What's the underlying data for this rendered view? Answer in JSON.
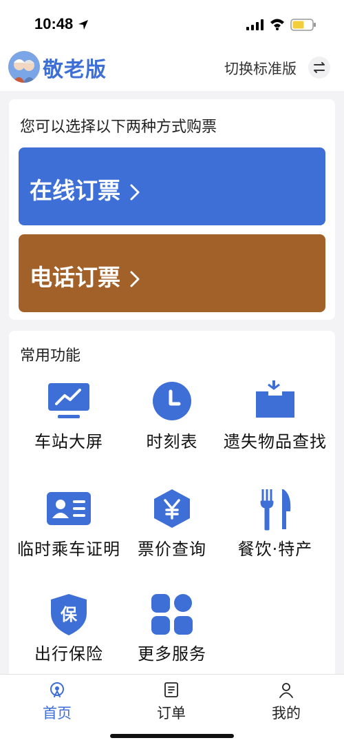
{
  "status_bar": {
    "time": "10:48",
    "icons": [
      "location-arrow-icon",
      "signal-icon",
      "wifi-icon",
      "battery-icon"
    ]
  },
  "header": {
    "brand": "敬老版",
    "switch_label": "切换标准版",
    "switch_icon": "swap-icon"
  },
  "ticket_card": {
    "title": "您可以选择以下两种方式购票",
    "online_label": "在线订票",
    "phone_label": "电话订票"
  },
  "functions": {
    "title": "常用功能",
    "items": [
      {
        "label": "车站大屏",
        "icon": "monitor-chart-icon"
      },
      {
        "label": "时刻表",
        "icon": "clock-icon"
      },
      {
        "label": "遗失物品查找",
        "icon": "lost-box-icon"
      },
      {
        "label": "临时乘车证明",
        "icon": "id-card-icon"
      },
      {
        "label": "票价查询",
        "icon": "yen-price-icon"
      },
      {
        "label": "餐饮·特产",
        "icon": "fork-knife-icon"
      },
      {
        "label": "出行保险",
        "icon": "insurance-shield-icon"
      },
      {
        "label": "更多服务",
        "icon": "grid-more-icon"
      }
    ]
  },
  "tabbar": {
    "tabs": [
      {
        "label": "首页",
        "icon": "train-home-icon",
        "active": true
      },
      {
        "label": "订单",
        "icon": "order-list-icon",
        "active": false
      },
      {
        "label": "我的",
        "icon": "user-icon",
        "active": false
      }
    ]
  },
  "colors": {
    "accent_blue": "#3d6fd6",
    "phone_brown": "#a3612a",
    "background": "#f3f3f5"
  }
}
